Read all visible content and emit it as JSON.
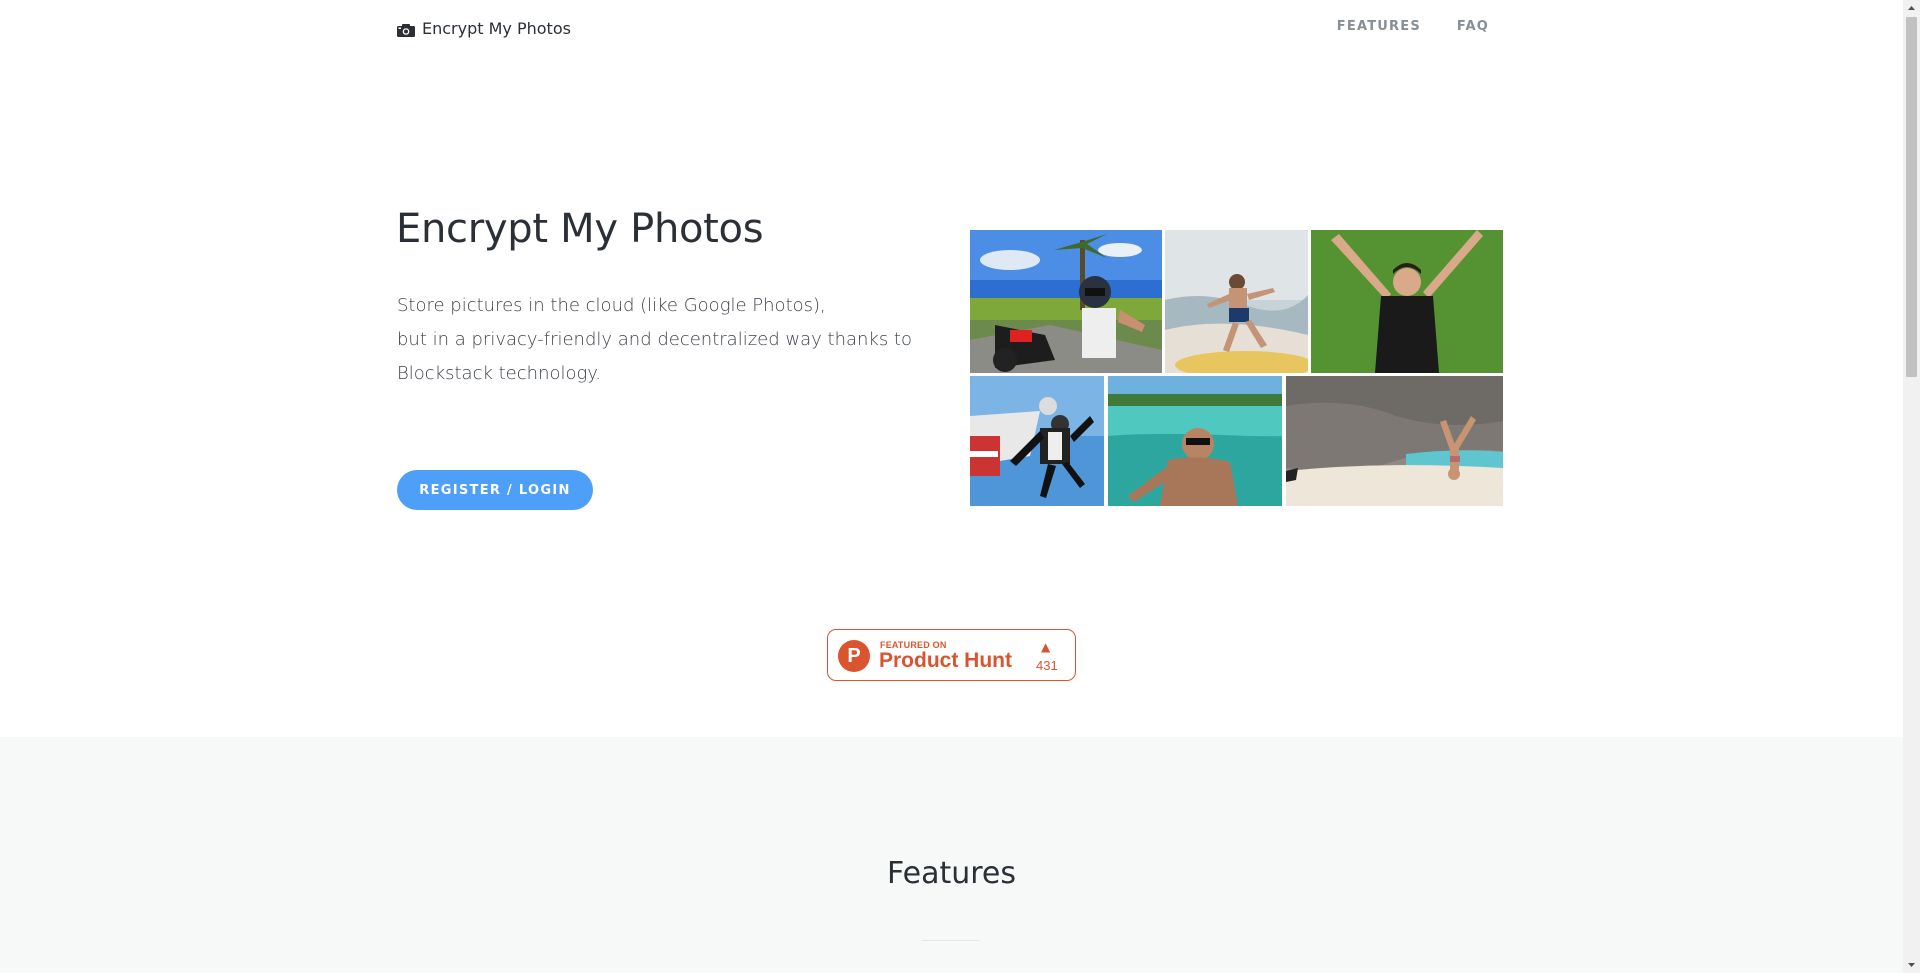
{
  "navbar": {
    "brand": "Encrypt My Photos",
    "links": [
      {
        "label": "FEATURES"
      },
      {
        "label": "FAQ"
      }
    ]
  },
  "hero": {
    "title": "Encrypt My Photos",
    "description_lines": [
      "Store pictures in the cloud (like Google Photos),",
      "but in a privacy-friendly and decentralized way thanks to",
      "Blockstack technology."
    ],
    "cta": "REGISTER / LOGIN"
  },
  "product_hunt": {
    "featured": "FEATURED ON",
    "name": "Product Hunt",
    "count": "431"
  },
  "features": {
    "title": "Features"
  },
  "colors": {
    "accent": "#4e9ff8",
    "product_hunt": "#da552f",
    "section_bg": "#f7f8f8"
  }
}
